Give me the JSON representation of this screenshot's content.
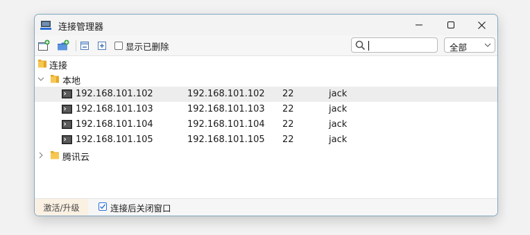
{
  "window": {
    "title": "连接管理器"
  },
  "toolbar": {
    "show_deleted_label": "显示已删除",
    "show_deleted_checked": false,
    "search": {
      "value": "",
      "placeholder": ""
    },
    "filter": {
      "selected": "全部"
    }
  },
  "tree": {
    "root": {
      "label": "连接"
    },
    "groups": [
      {
        "label": "本地",
        "expanded": true,
        "items": [
          {
            "name": "192.168.101.102",
            "host": "192.168.101.102",
            "port": "22",
            "user": "jack"
          },
          {
            "name": "192.168.101.103",
            "host": "192.168.101.103",
            "port": "22",
            "user": "jack"
          },
          {
            "name": "192.168.101.104",
            "host": "192.168.101.104",
            "port": "22",
            "user": "jack"
          },
          {
            "name": "192.168.101.105",
            "host": "192.168.101.105",
            "port": "22",
            "user": "jack"
          }
        ]
      },
      {
        "label": "腾讯云",
        "expanded": false
      }
    ]
  },
  "statusbar": {
    "activate_label": "激活/升级",
    "close_after_connect_label": "连接后关闭窗口",
    "close_after_connect_checked": true
  },
  "colors": {
    "accent": "#2a6fd6",
    "folder": "#f0b93a",
    "window_border": "#7fa7c0"
  }
}
